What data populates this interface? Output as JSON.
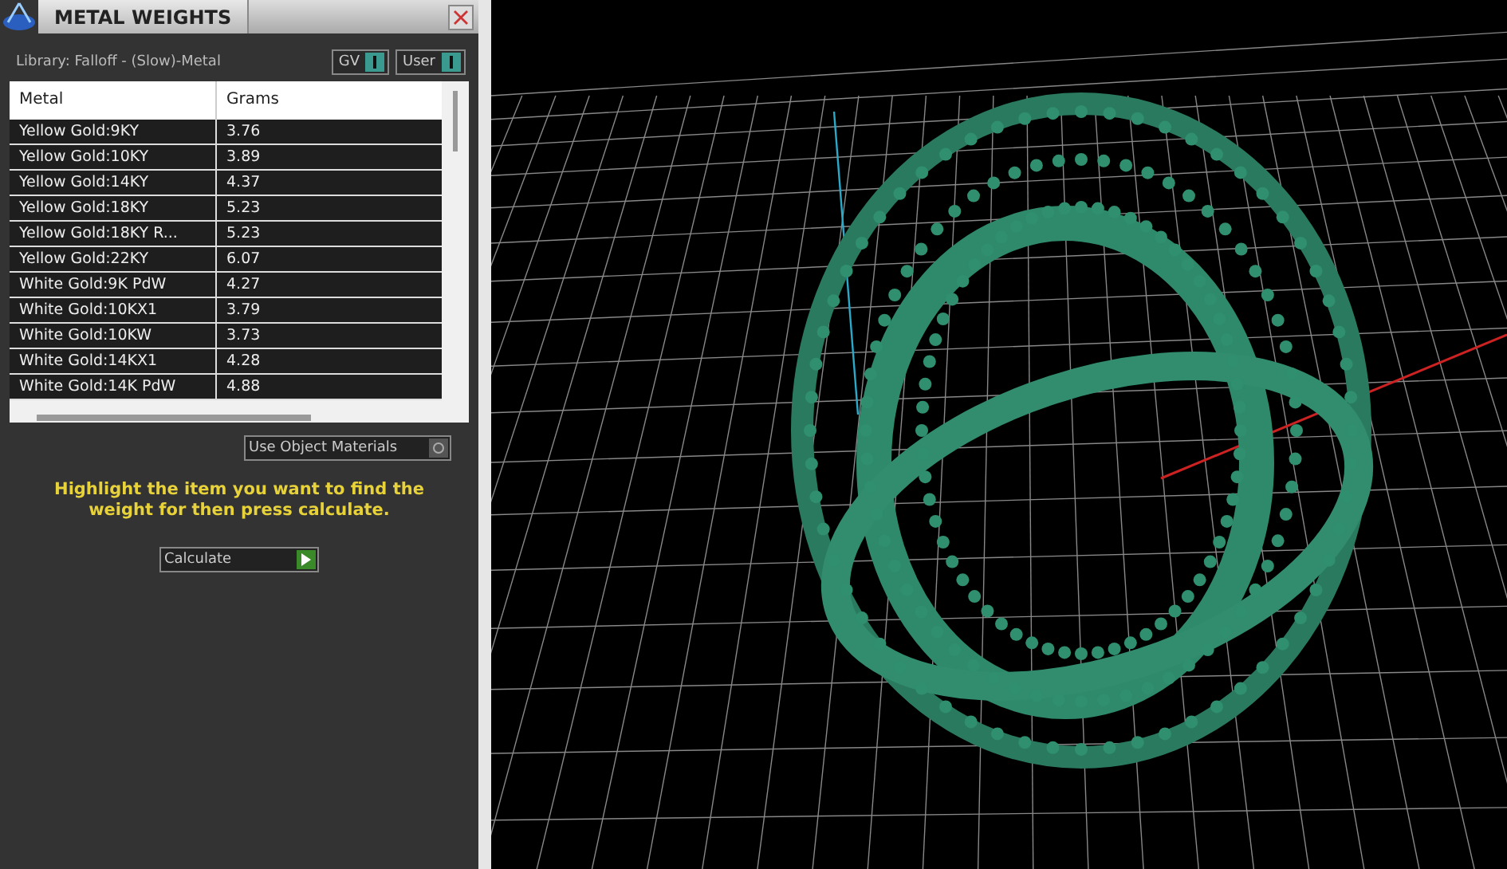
{
  "panel": {
    "title": "METAL WEIGHTS",
    "library": "Library: Falloff - (Slow)-Metal",
    "toggles": [
      {
        "label": "GV",
        "on": true
      },
      {
        "label": "User",
        "on": true
      }
    ],
    "table": {
      "columns": [
        "Metal",
        "Grams"
      ],
      "rows": [
        {
          "metal": "Yellow Gold:9KY",
          "grams": "3.76"
        },
        {
          "metal": "Yellow Gold:10KY",
          "grams": "3.89"
        },
        {
          "metal": "Yellow Gold:14KY",
          "grams": "4.37"
        },
        {
          "metal": "Yellow Gold:18KY",
          "grams": "5.23"
        },
        {
          "metal": "Yellow Gold:18KY R...",
          "grams": "5.23"
        },
        {
          "metal": "Yellow Gold:22KY",
          "grams": "6.07"
        },
        {
          "metal": "White Gold:9K PdW",
          "grams": "4.27"
        },
        {
          "metal": "White Gold:10KX1",
          "grams": "3.79"
        },
        {
          "metal": "White Gold:10KW",
          "grams": "3.73"
        },
        {
          "metal": "White Gold:14KX1",
          "grams": "4.28"
        },
        {
          "metal": "White Gold:14K PdW",
          "grams": "4.88"
        }
      ]
    },
    "use_object_materials": {
      "label": "Use Object Materials",
      "on": false
    },
    "hint": "Highlight the item you want to find the weight for then press calculate.",
    "calculate": "Calculate"
  }
}
